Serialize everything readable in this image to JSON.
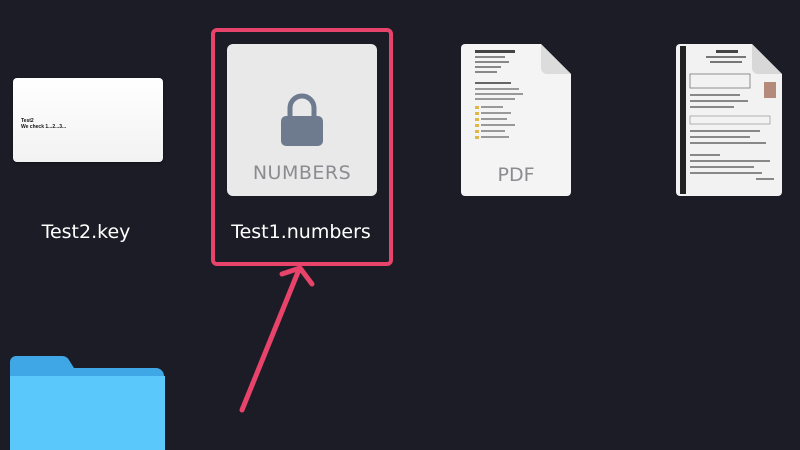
{
  "files": [
    {
      "name": "Test2.key",
      "thumb_line1": "Test2",
      "thumb_line2": "We check 1...2...3...",
      "icon": "keynote-document-icon"
    },
    {
      "name": "Test1.numbers",
      "thumb_label": "NUMBERS",
      "icon": "lock-icon",
      "locked": true,
      "highlighted": true
    },
    {
      "name": "",
      "thumb_label": "PDF",
      "icon": "pdf-document-icon"
    },
    {
      "name": "",
      "icon": "pdf-document-icon"
    },
    {
      "name": "",
      "icon": "folder-icon"
    }
  ],
  "colors": {
    "background": "#1c1c26",
    "highlight": "#e8436b",
    "folder": "#5ac8fa"
  }
}
